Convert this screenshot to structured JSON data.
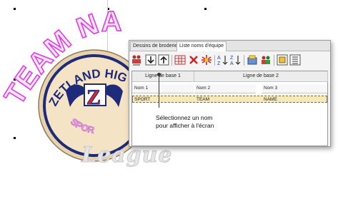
{
  "tabs": [
    "Dessins de broderie",
    "Liste noms d'équipe"
  ],
  "toolbar": {
    "icons": [
      "add-name-icon",
      "move-down-icon",
      "move-up-icon",
      "grid-table-icon",
      "delete-icon",
      "asterisk-icon",
      "sort-ascending-icon",
      "sort-descending-icon",
      "import-icon",
      "add-team-icon",
      "export-icon",
      "list-icon"
    ]
  },
  "table": {
    "groups": [
      "Ligne de base 1",
      "Ligne de base 2"
    ],
    "columns": [
      "Nom 1",
      "Nom 2",
      "Nom 3"
    ],
    "rows": [
      [
        "SPORT",
        "TEAM",
        "NAME"
      ]
    ]
  },
  "callout": {
    "line1": "Sélectionnez un nom",
    "line2": "pour afficher à l'écran"
  },
  "design": {
    "arc_text": "TEAM NA",
    "badge_top": "ZETLAND HIG",
    "badge_letter": "Z",
    "badge_bottom": "SPOR",
    "watermark": "League"
  },
  "colors": {
    "magenta": "#e23ae6",
    "navy": "#1e2a7a",
    "red": "#d8262f",
    "badge_fill": "#f4e3c4",
    "selection": "#f7e9b9"
  }
}
